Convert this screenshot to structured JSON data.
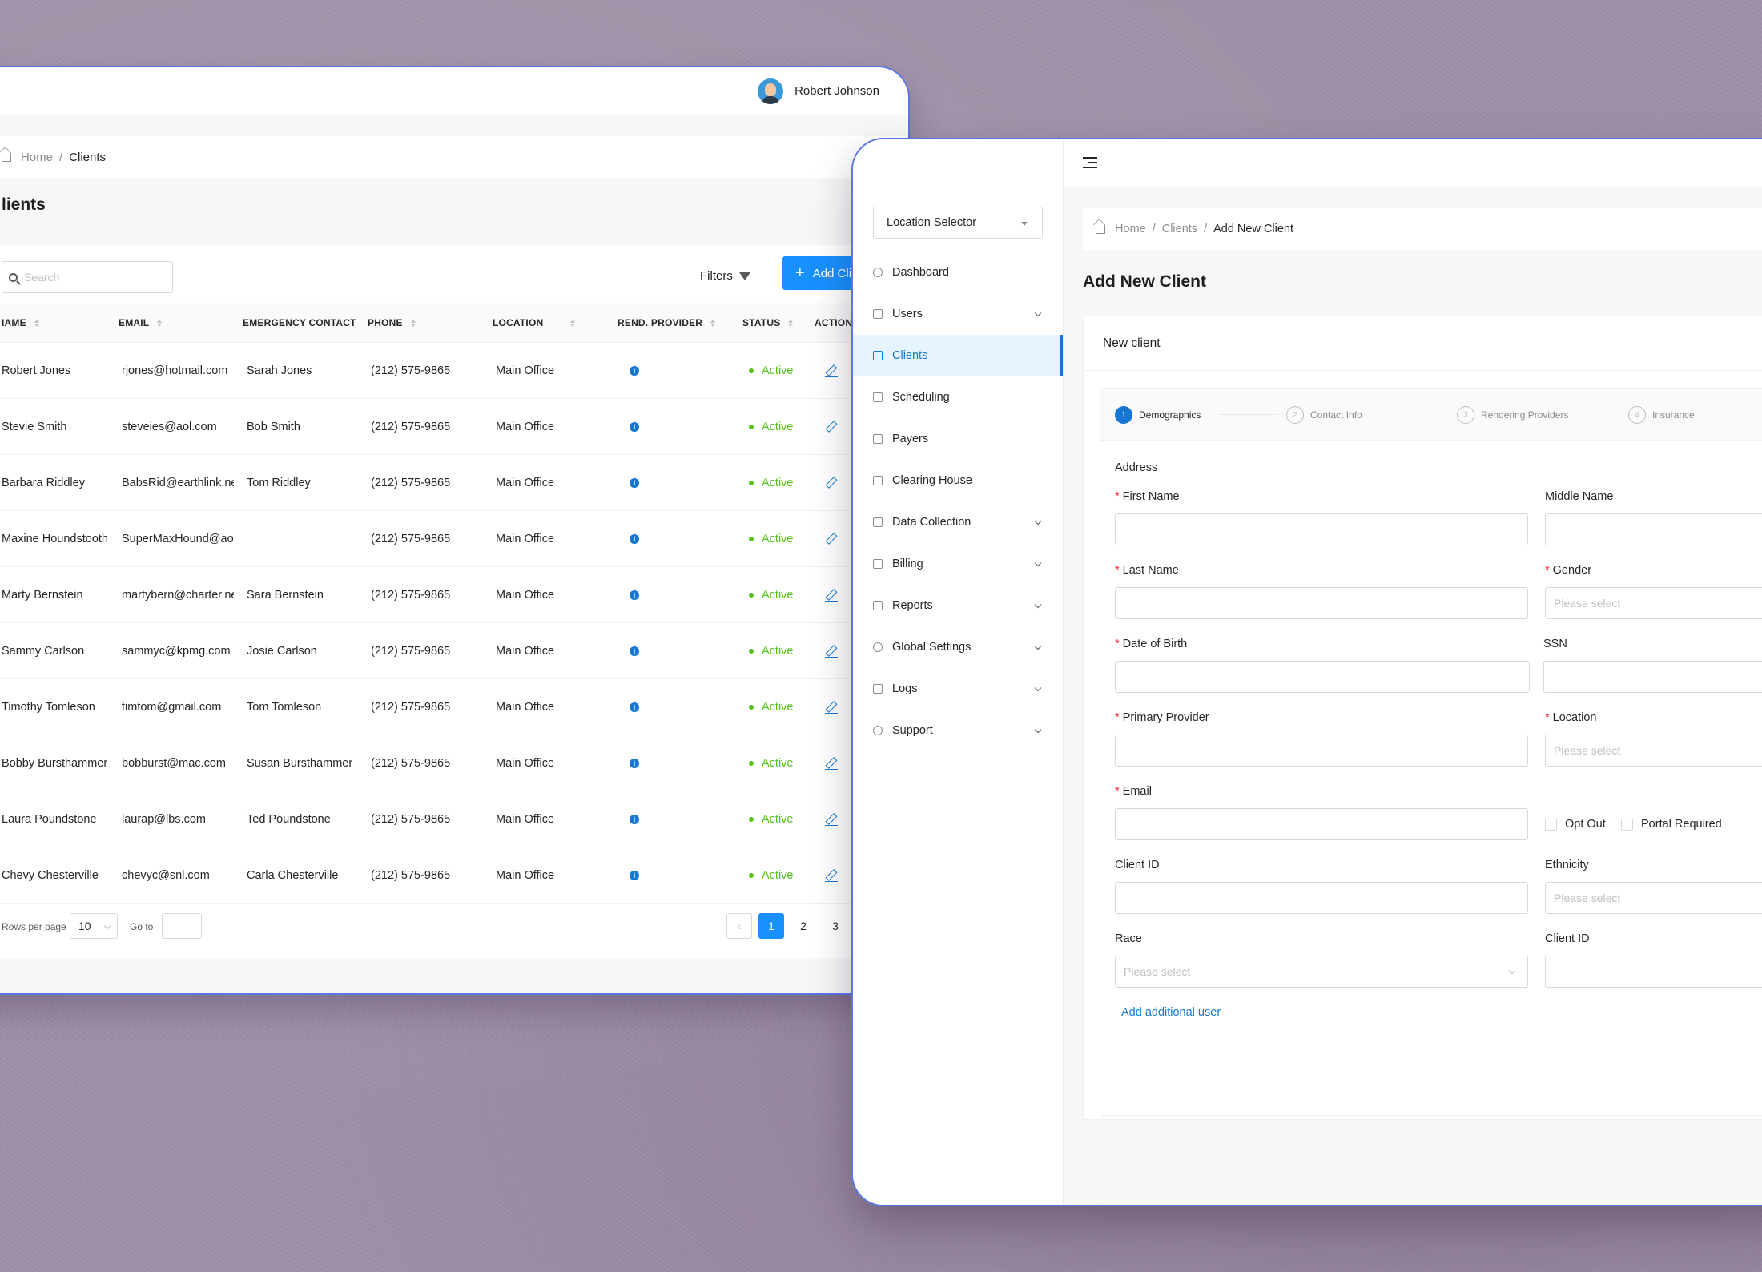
{
  "back_window": {
    "user_name": "Robert Johnson",
    "breadcrumb": {
      "home": "Home",
      "sep": "/",
      "current": "Clients"
    },
    "page_title": "lients",
    "search_placeholder": "Search",
    "filters_label": "Filters",
    "add_button_label": "Add Cli",
    "columns": [
      "NAME",
      "EMAIL",
      "EMERGENCY CONTACT",
      "PHONE",
      "LOCATION",
      "REND. PROVIDER",
      "STATUS",
      "ACTIONS"
    ],
    "columns_visible": [
      "IAME",
      "EMAIL",
      "EMERGENCY CONTACT",
      "PHONE",
      "LOCATION",
      "REND. PROVIDER",
      "STATUS",
      "ACTION"
    ],
    "rows": [
      {
        "name": "Robert Jones",
        "email": "rjones@hotmail.com",
        "emergency": "Sarah Jones",
        "phone": "(212) 575-9865",
        "location": "Main Office",
        "status": "Active"
      },
      {
        "name": "Stevie Smith",
        "email": "steveies@aol.com",
        "emergency": "Bob Smith",
        "phone": "(212) 575-9865",
        "location": "Main Office",
        "status": "Active"
      },
      {
        "name": "Barbara Riddley",
        "email": "BabsRid@earthlink.ne",
        "emergency": "Tom Riddley",
        "phone": "(212) 575-9865",
        "location": "Main Office",
        "status": "Active"
      },
      {
        "name": "Maxine Houndstooth",
        "email": "SuperMaxHound@aol",
        "emergency": "",
        "phone": "(212) 575-9865",
        "location": "Main Office",
        "status": "Active"
      },
      {
        "name": "Marty Bernstein",
        "email": "martybern@charter.ne",
        "emergency": "Sara Bernstein",
        "phone": "(212) 575-9865",
        "location": "Main Office",
        "status": "Active"
      },
      {
        "name": "Sammy Carlson",
        "email": "sammyc@kpmg.com",
        "emergency": "Josie Carlson",
        "phone": "(212) 575-9865",
        "location": "Main Office",
        "status": "Active"
      },
      {
        "name": "Timothy Tomleson",
        "email": "timtom@gmail.com",
        "emergency": "Tom Tomleson",
        "phone": "(212) 575-9865",
        "location": "Main Office",
        "status": "Active"
      },
      {
        "name": "Bobby Bursthammer",
        "email": "bobburst@mac.com",
        "emergency": "Susan Bursthammer",
        "phone": "(212) 575-9865",
        "location": "Main Office",
        "status": "Active"
      },
      {
        "name": "Laura Poundstone",
        "email": "laurap@lbs.com",
        "emergency": "Ted Poundstone",
        "phone": "(212) 575-9865",
        "location": "Main Office",
        "status": "Active"
      },
      {
        "name": "Chevy Chesterville",
        "email": "chevyc@snl.com",
        "emergency": "Carla Chesterville",
        "phone": "(212) 575-9865",
        "location": "Main Office",
        "status": "Active"
      }
    ],
    "pager": {
      "rows_per_page_label": "Rows per page",
      "rows_per_page_value": "10",
      "goto_label": "Go to",
      "pages": [
        "1",
        "2",
        "3"
      ],
      "current_page": "1"
    }
  },
  "front_window": {
    "location_selector": "Location Selector",
    "nav": [
      {
        "label": "Dashboard",
        "icon": "dashboard-icon",
        "expandable": false
      },
      {
        "label": "Users",
        "icon": "user-icon",
        "expandable": true
      },
      {
        "label": "Clients",
        "icon": "clients-icon",
        "expandable": false,
        "active": true
      },
      {
        "label": "Scheduling",
        "icon": "calendar-icon",
        "expandable": false
      },
      {
        "label": "Payers",
        "icon": "payers-icon",
        "expandable": false
      },
      {
        "label": "Clearing House",
        "icon": "mail-icon",
        "expandable": false
      },
      {
        "label": "Data Collection",
        "icon": "file-icon",
        "expandable": true
      },
      {
        "label": "Billing",
        "icon": "billing-icon",
        "expandable": true
      },
      {
        "label": "Reports",
        "icon": "reports-icon",
        "expandable": true
      },
      {
        "label": "Global Settings",
        "icon": "gear-icon",
        "expandable": true
      },
      {
        "label": "Logs",
        "icon": "list-icon",
        "expandable": true
      },
      {
        "label": "Support",
        "icon": "headset-icon",
        "expandable": true
      }
    ],
    "breadcrumb": {
      "home": "Home",
      "sep": "/",
      "clients": "Clients",
      "current": "Add New Client"
    },
    "page_title": "Add New Client",
    "card_title": "New client",
    "steps": [
      {
        "num": "1",
        "label": "Demographics",
        "active": true
      },
      {
        "num": "2",
        "label": "Contact Info"
      },
      {
        "num": "3",
        "label": "Rendering Providers"
      },
      {
        "num": "4",
        "label": "Insurance"
      }
    ],
    "section_label": "Address",
    "fields": {
      "first_name": "First Name",
      "middle_name": "Middle Name",
      "last_name": "Last Name",
      "gender": "Gender",
      "dob": "Date of Birth",
      "ssn": "SSN",
      "primary_provider": "Primary Provider",
      "location": "Location",
      "email": "Email",
      "opt_out": "Opt Out",
      "portal_required": "Portal Required",
      "client_id": "Client ID",
      "ethnicity": "Ethnicity",
      "race": "Race",
      "client_id_2": "Client ID"
    },
    "placeholder_select": "Please select",
    "add_additional_user": "Add additional user"
  },
  "colors": {
    "accent": "#1890ff",
    "active_status": "#52c41a",
    "window_border": "#5b74e6",
    "danger": "#f5222d"
  }
}
